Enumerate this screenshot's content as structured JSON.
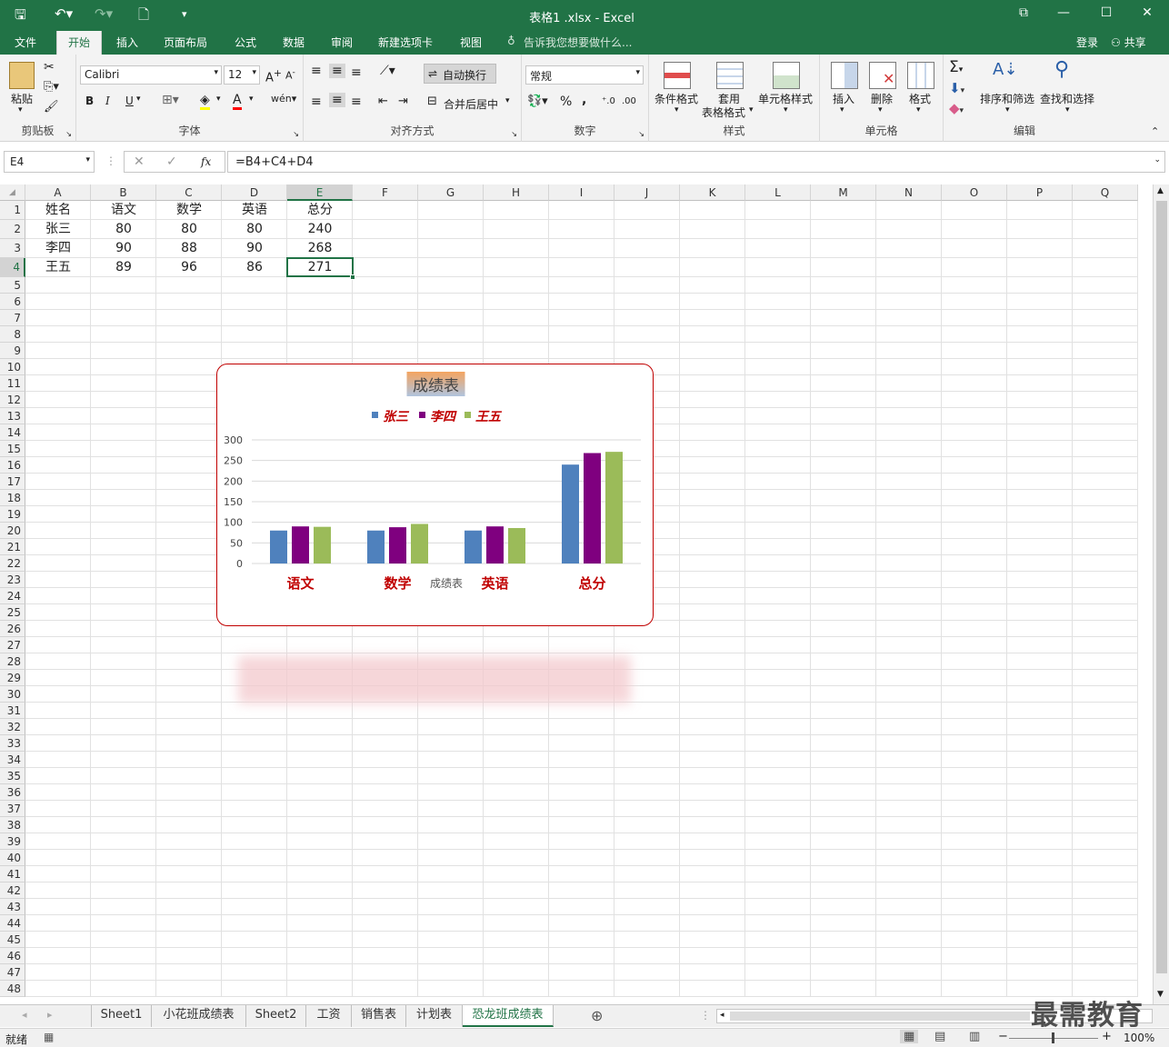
{
  "window": {
    "title": "表格1 .xlsx - Excel",
    "min": "—",
    "restore": "❐",
    "max": "☐",
    "close": "✕"
  },
  "tabs": [
    "文件",
    "开始",
    "插入",
    "页面布局",
    "公式",
    "数据",
    "审阅",
    "新建选项卡",
    "视图"
  ],
  "tell_me": "告诉我您想要做什么...",
  "account": {
    "login": "登录",
    "share": "共享"
  },
  "ribbon": {
    "clipboard": {
      "label": "剪贴板",
      "paste": "粘贴"
    },
    "font": {
      "label": "字体",
      "name": "Calibri",
      "size": "12",
      "bold": "B",
      "italic": "I",
      "underline": "U"
    },
    "align": {
      "label": "对齐方式",
      "wrap": "自动换行",
      "merge": "合并后居中"
    },
    "number": {
      "label": "数字",
      "format": "常规",
      "percent": "%",
      "comma": ","
    },
    "styles": {
      "label": "样式",
      "cond": "条件格式",
      "table1": "套用",
      "table2": "表格格式",
      "cell_style": "单元格样式"
    },
    "cells": {
      "label": "单元格",
      "insert": "插入",
      "delete": "删除",
      "format": "格式"
    },
    "edit": {
      "label": "编辑",
      "sort": "排序和筛选",
      "find": "查找和选择"
    }
  },
  "formula_bar": {
    "name_box": "E4",
    "formula": "=B4+C4+D4",
    "fx": "fx"
  },
  "columns": [
    "A",
    "B",
    "C",
    "D",
    "E",
    "F",
    "G",
    "H",
    "I",
    "J",
    "K",
    "L",
    "M",
    "N",
    "O",
    "P",
    "Q"
  ],
  "table": [
    [
      "姓名",
      "语文",
      "数学",
      "英语",
      "总分"
    ],
    [
      "张三",
      "80",
      "80",
      "80",
      "240"
    ],
    [
      "李四",
      "90",
      "88",
      "90",
      "268"
    ],
    [
      "王五",
      "89",
      "96",
      "86",
      "271"
    ]
  ],
  "chart_data": {
    "type": "bar",
    "title": "成绩表",
    "categories": [
      "语文",
      "数学",
      "英语",
      "总分"
    ],
    "series": [
      {
        "name": "张三",
        "values": [
          80,
          80,
          80,
          240
        ],
        "color": "#4f81bd"
      },
      {
        "name": "李四",
        "values": [
          90,
          88,
          90,
          268
        ],
        "color": "#7f007f"
      },
      {
        "name": "王五",
        "values": [
          89,
          96,
          86,
          271
        ],
        "color": "#9bbb59"
      }
    ],
    "yticks": [
      0,
      50,
      100,
      150,
      200,
      250,
      300
    ],
    "ylim": [
      0,
      300
    ],
    "xlabel": "成绩表",
    "legend": "top",
    "grid": true,
    "label_color": "#c00000"
  },
  "sheets": [
    "Sheet1",
    "小花班成绩表",
    "Sheet2",
    "工资",
    "销售表",
    "计划表",
    "恐龙班成绩表"
  ],
  "active_sheet": "恐龙班成绩表",
  "status": {
    "ready": "就绪",
    "zoom": "100%"
  },
  "watermark": "最需教育"
}
